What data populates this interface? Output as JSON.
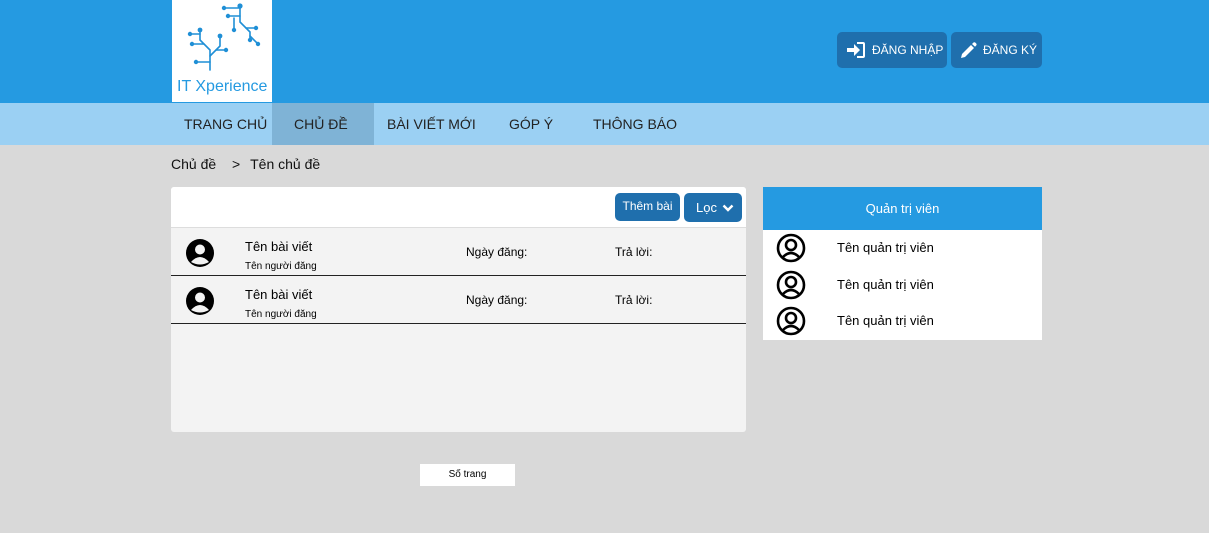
{
  "header": {
    "logo_text": "IT Xperience",
    "login_label": "ĐĂNG NHẬP",
    "register_label": "ĐĂNG KÝ",
    "login_icon": "sign-in-icon",
    "register_icon": "pencil-icon"
  },
  "nav": {
    "items": [
      {
        "label": "TRANG CHỦ"
      },
      {
        "label": "CHỦ ĐỀ"
      },
      {
        "label": "BÀI VIẾT MỚI"
      },
      {
        "label": "GÓP Ý"
      },
      {
        "label": "THÔNG BÁO"
      }
    ],
    "active_index": 1
  },
  "breadcrumb": {
    "root": "Chủ đề",
    "separator": ">",
    "current": "Tên chủ đề"
  },
  "posts": {
    "add_label": "Thêm bài",
    "filter_label": "Lọc",
    "rows": [
      {
        "title": "Tên bài viết",
        "author": "Tên người đăng",
        "date_label": "Ngày đăng:",
        "replies_label": "Trả lời:"
      },
      {
        "title": "Tên bài viết",
        "author": "Tên người đăng",
        "date_label": "Ngày đăng:",
        "replies_label": "Trả lời:"
      }
    ]
  },
  "pagination": {
    "label": "Số trang"
  },
  "admins": {
    "title": "Quản trị viên",
    "items": [
      {
        "name": "Tên quản trị viên"
      },
      {
        "name": "Tên quản trị viên"
      },
      {
        "name": "Tên quản trị viên"
      }
    ]
  },
  "colors": {
    "header_bg": "#259ae1",
    "nav_bg": "#9bd0f3",
    "button_bg": "#1f6fad",
    "page_bg": "#d9d9d9"
  }
}
